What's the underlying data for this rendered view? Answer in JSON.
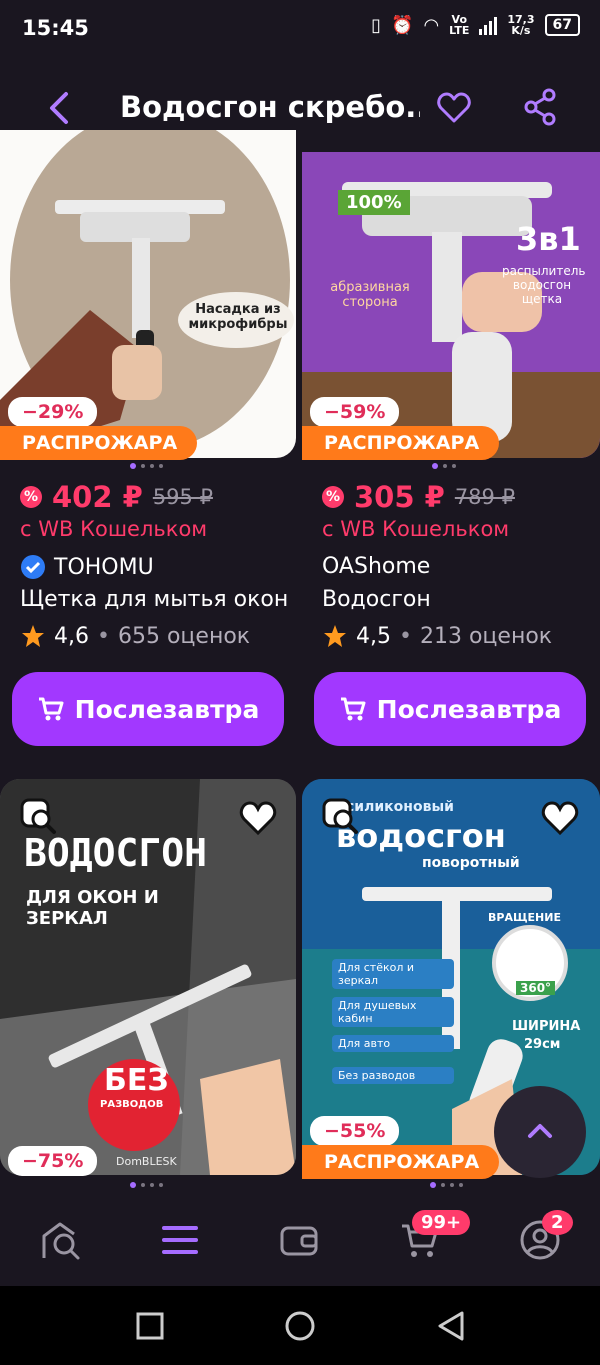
{
  "status": {
    "time": "15:45",
    "net_speed_top": "17,3",
    "net_speed_unit": "K/s",
    "battery": "67",
    "lte_top": "Vo",
    "lte_bottom": "LTE"
  },
  "header": {
    "title": "Водосгон скребо...",
    "back_icon": "chevron-left-icon",
    "fav_icon": "heart-icon",
    "share_icon": "share-icon"
  },
  "products": [
    {
      "image_text": "Насадка из микрофибры",
      "discount": "−29%",
      "sale_label": "РАСПРОЖАРА",
      "price": "402 ₽",
      "old_price": "595 ₽",
      "wallet_note": "с WB Кошельком",
      "brand": "TOHOMU",
      "verified": true,
      "name": "Щетка для мытья окон",
      "rating": "4,6",
      "reviews": "655 оценок",
      "buy_label": "Послезавтра"
    },
    {
      "image_text_left": "абразивная сторона",
      "image_text_right": "распылитель водосгон щетка",
      "image_badge": "3в1",
      "image_percent": "100%",
      "discount": "−59%",
      "sale_label": "РАСПРОЖАРА",
      "price": "305 ₽",
      "old_price": "789 ₽",
      "wallet_note": "с WB Кошельком",
      "brand": "OAShome",
      "verified": false,
      "name": "Водосгон",
      "rating": "4,5",
      "reviews": "213 оценок",
      "buy_label": "Послезавтра"
    },
    {
      "image_title": "ВОДОСГОН",
      "image_sub": "ДЛЯ ОКОН И ЗЕРКАЛ",
      "image_badge_big": "БЕЗ",
      "image_badge_small": "РАЗВОДОВ",
      "image_brand": "DomBLESK",
      "discount": "−75%"
    },
    {
      "image_pre": "силиконовый",
      "image_title": "водосгон",
      "image_sub": "поворотный",
      "image_items": [
        "Для стёкол и зеркал",
        "Для душевых кабин",
        "Для авто",
        "Без разводов"
      ],
      "image_rotate": "ВРАЩЕНИЕ",
      "image_deg": "360°",
      "image_width": "ШИРИНА",
      "image_width_val": "29см",
      "discount": "−55%",
      "sale_label": "РАСПРОЖАРА"
    }
  ],
  "bottom_nav": {
    "cart_badge": "99+",
    "profile_badge": "2"
  },
  "colors": {
    "accent": "#a238ff",
    "price": "#ff3b6b",
    "sale": "#ff7a1a",
    "bg": "#1a1620"
  }
}
